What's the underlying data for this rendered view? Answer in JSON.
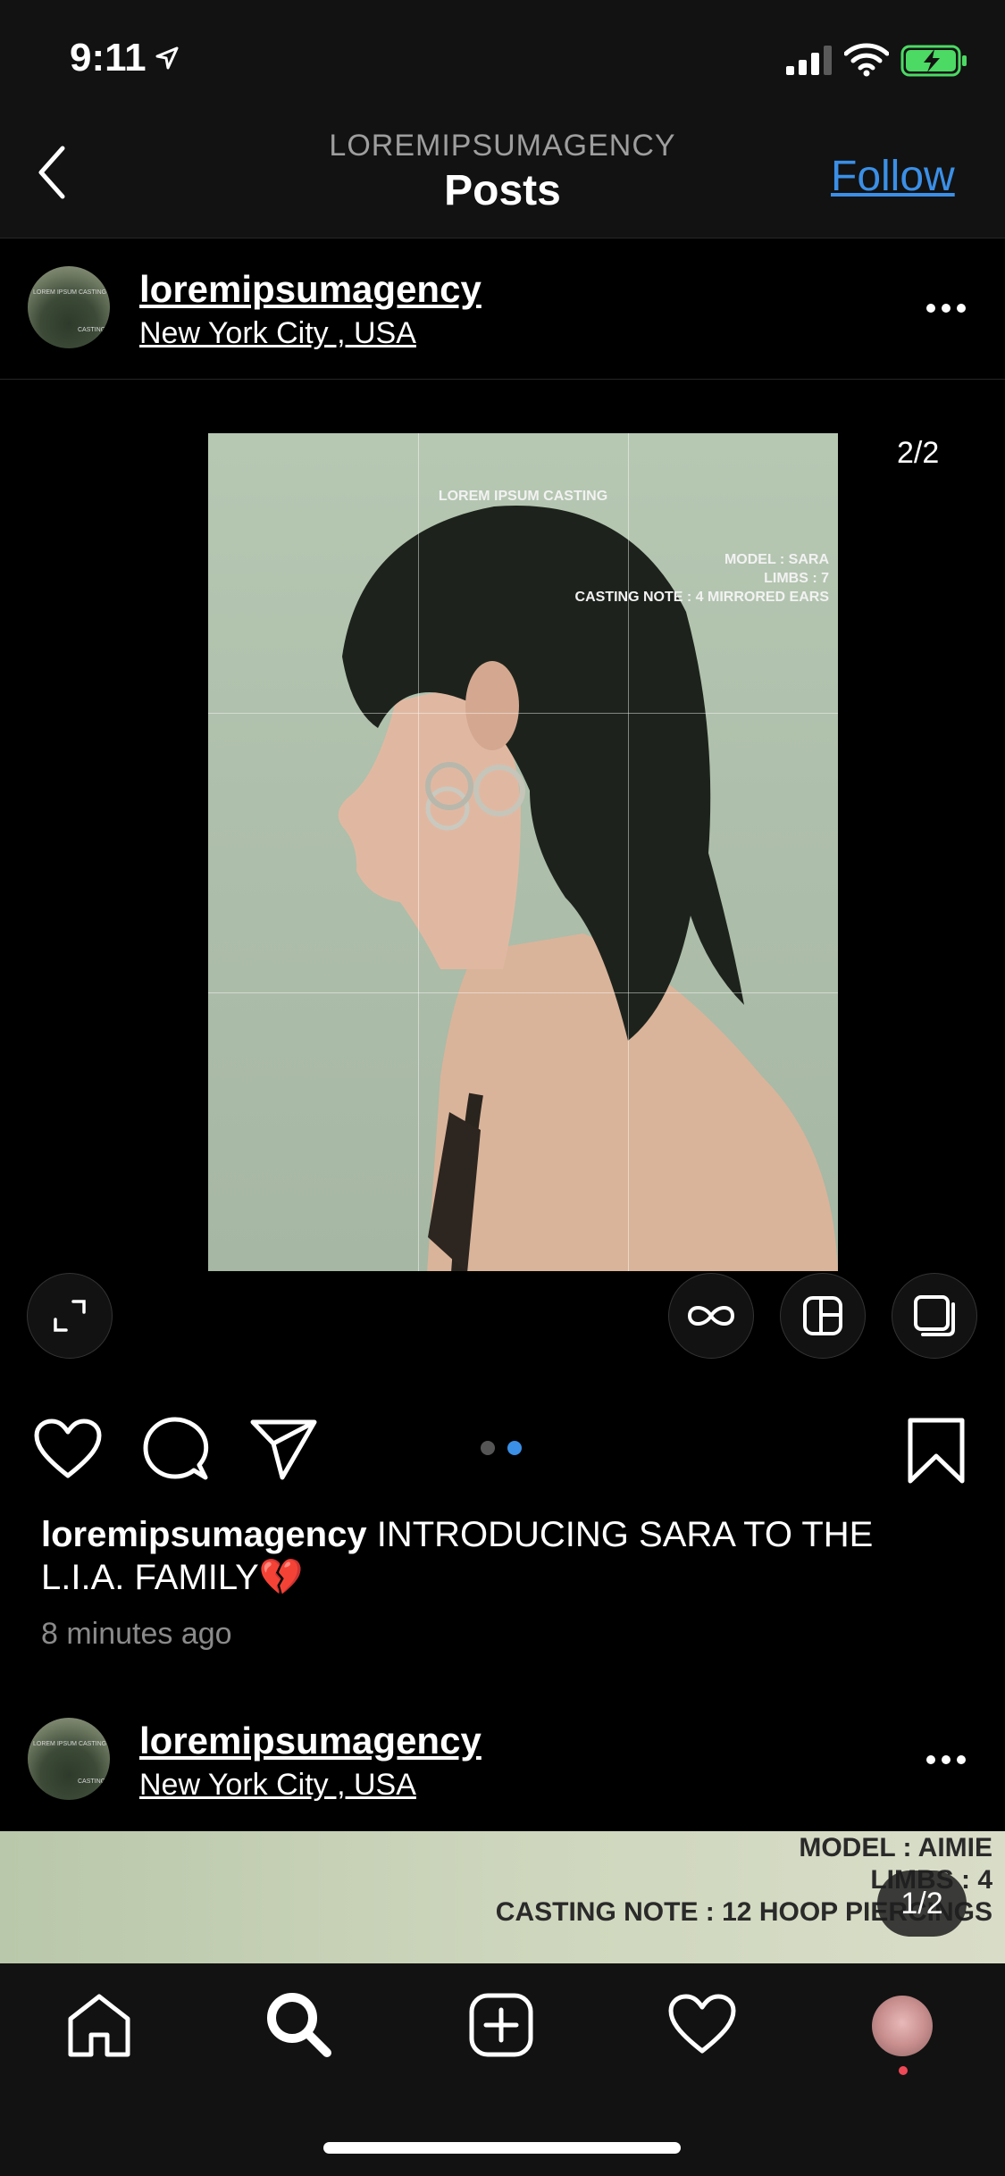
{
  "status_bar": {
    "time": "9:11"
  },
  "nav": {
    "subtitle": "LOREMIPSUMAGENCY",
    "title": "Posts",
    "follow_label": "Follow"
  },
  "post1": {
    "username": "loremipsumagency",
    "location": "New York City , USA",
    "avatar_text": {
      "top": "LOREM IPSUM CASTING",
      "bottom": "CASTING"
    },
    "image_counter": "2/2",
    "photo": {
      "header": "LOREM IPSUM CASTING",
      "meta_lines": [
        "MODEL : SARA",
        "LIMBS : 7",
        "CASTING NOTE : 4 MIRRORED EARS"
      ]
    },
    "caption_username": "loremipsumagency",
    "caption_text": " INTRODUCING SARA TO THE L.I.A. FAMILY💔",
    "time_ago": "8 minutes ago"
  },
  "post2": {
    "username": "loremipsumagency",
    "location": "New York City , USA",
    "avatar_text": {
      "top": "LOREM IPSUM CASTING",
      "bottom": "CASTING"
    },
    "strip_lines": [
      "MODEL : AIMIE",
      "LIMBS : 4",
      "CASTING NOTE : 12 HOOP PIERCINGS"
    ],
    "image_counter": "1/2"
  },
  "colors": {
    "accent": "#3b8fe6",
    "background": "#000000",
    "bar": "#121212",
    "notification": "#ed4956"
  },
  "icons": [
    "location-arrow-icon",
    "signal-icon",
    "wifi-icon",
    "battery-icon",
    "back-chevron-icon",
    "more-icon",
    "expand-icon",
    "boomerang-icon",
    "layout-icon",
    "multi-image-icon",
    "heart-icon",
    "comment-icon",
    "share-icon",
    "bookmark-icon",
    "home-icon",
    "search-icon",
    "add-icon",
    "activity-icon"
  ]
}
